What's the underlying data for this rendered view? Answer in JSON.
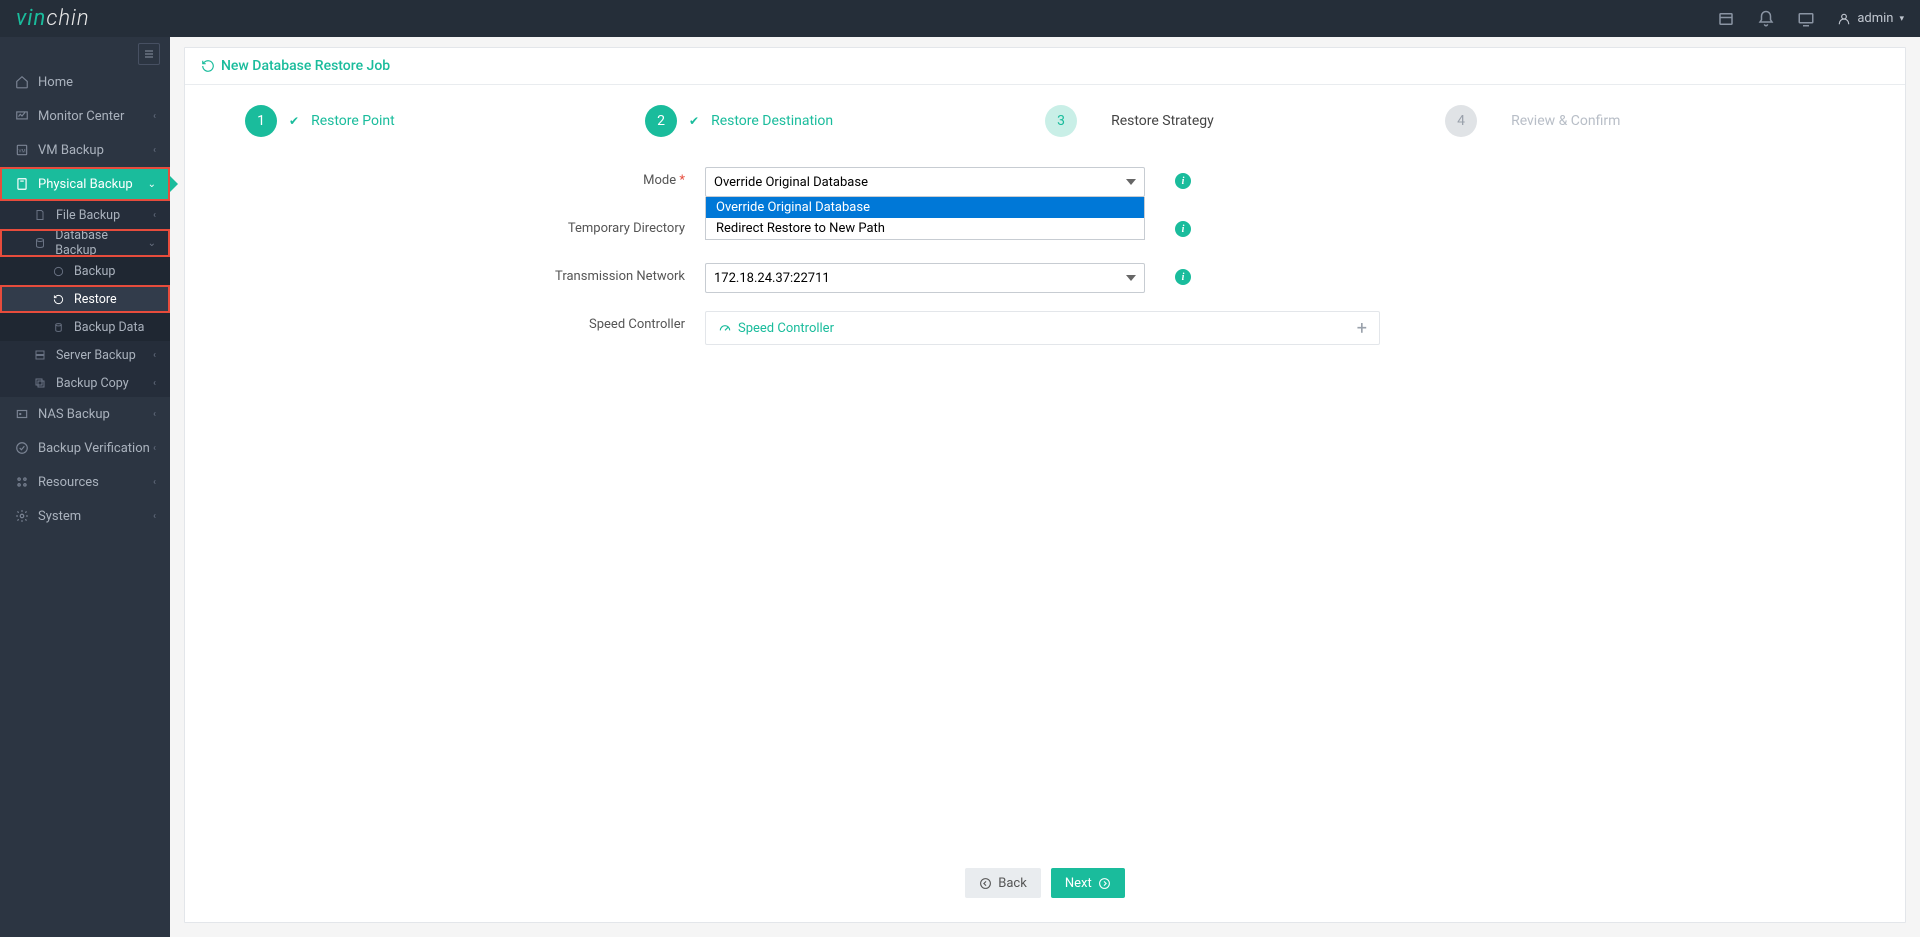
{
  "header": {
    "logo_vin": "vin",
    "logo_chin": "chin",
    "user_label": "admin"
  },
  "sidebar": {
    "items": [
      {
        "label": "Home"
      },
      {
        "label": "Monitor Center"
      },
      {
        "label": "VM Backup"
      },
      {
        "label": "Physical Backup"
      },
      {
        "label": "NAS Backup"
      },
      {
        "label": "Backup Verification"
      },
      {
        "label": "Resources"
      },
      {
        "label": "System"
      }
    ],
    "physical_sub": [
      {
        "label": "File Backup"
      },
      {
        "label": "Database Backup"
      },
      {
        "label": "Server Backup"
      },
      {
        "label": "Backup Copy"
      }
    ],
    "database_sub": [
      {
        "label": "Backup"
      },
      {
        "label": "Restore"
      },
      {
        "label": "Backup Data"
      }
    ]
  },
  "page": {
    "title": "New Database Restore Job",
    "steps": [
      {
        "num": "1",
        "label": "Restore Point"
      },
      {
        "num": "2",
        "label": "Restore Destination"
      },
      {
        "num": "3",
        "label": "Restore Strategy"
      },
      {
        "num": "4",
        "label": "Review & Confirm"
      }
    ],
    "form": {
      "mode_label": "Mode",
      "mode_value": "Override Original Database",
      "mode_options": [
        "Override Original Database",
        "Redirect Restore to New Path"
      ],
      "temp_dir_label": "Temporary Directory",
      "trans_net_label": "Transmission Network",
      "trans_net_value": "172.18.24.37:22711",
      "speed_label": "Speed Controller",
      "speed_link": "Speed Controller"
    },
    "buttons": {
      "back": "Back",
      "next": "Next"
    }
  }
}
